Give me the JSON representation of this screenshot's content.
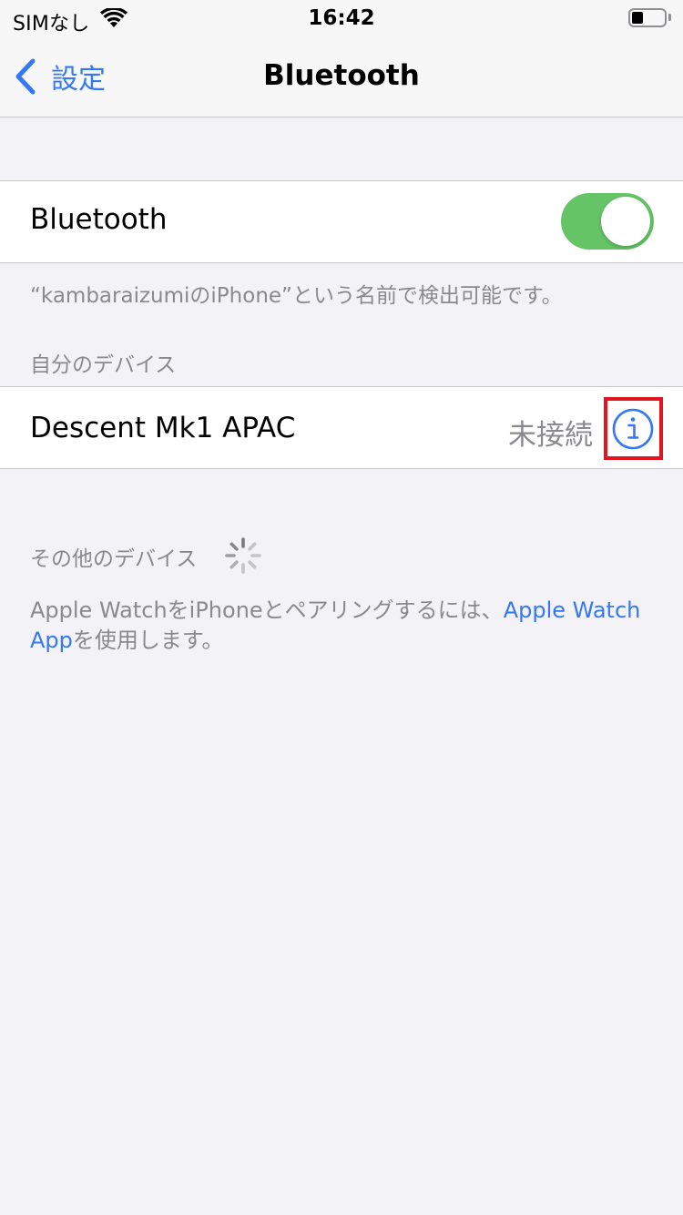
{
  "status_bar": {
    "carrier": "SIMなし",
    "time": "16:42",
    "battery_fraction": 0.25
  },
  "nav": {
    "back_label": "設定",
    "title": "Bluetooth"
  },
  "bluetooth": {
    "label": "Bluetooth",
    "enabled": true,
    "toggle_color": "#65c466",
    "discoverable_text": "“kambaraizumiのiPhone”という名前で検出可能です。"
  },
  "my_devices": {
    "header": "自分のデバイス",
    "items": [
      {
        "name": "Descent Mk1 APAC",
        "status": "未接続"
      }
    ]
  },
  "other_devices": {
    "header": "その他のデバイス",
    "pairing_text_before": "Apple WatchをiPhoneとペアリングするには、",
    "pairing_link": "Apple Watch App",
    "pairing_text_after": "を使用します。"
  },
  "colors": {
    "accent": "#3478f6",
    "highlight": "#e3141e",
    "background": "#f2f2f7"
  },
  "icons": {
    "back": "chevron-left-icon",
    "info": "info-circle-icon",
    "wifi": "wifi-icon",
    "battery": "battery-icon",
    "spinner": "activity-spinner-icon"
  }
}
